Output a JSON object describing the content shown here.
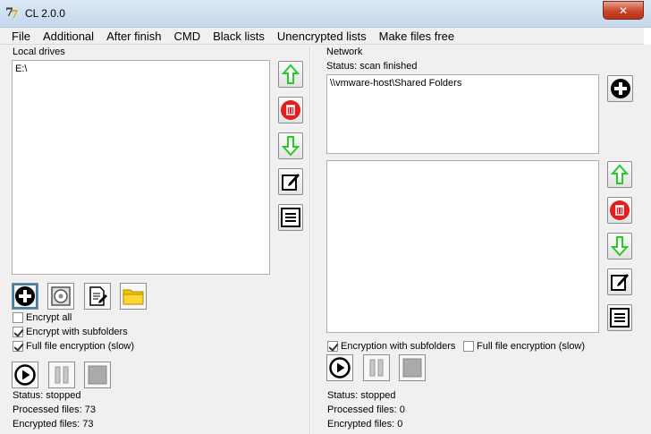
{
  "window": {
    "title": "CL 2.0.0",
    "close_glyph": "✕"
  },
  "menu": [
    "File",
    "Additional",
    "After finish",
    "CMD",
    "Black lists",
    "Unencrypted lists",
    "Make files free"
  ],
  "local": {
    "section_label": "Local drives",
    "drives": [
      "E:\\"
    ],
    "checkboxes": [
      {
        "label": "Encrypt all",
        "checked": false
      },
      {
        "label": "Encrypt with subfolders",
        "checked": true
      },
      {
        "label": "Full file encryption (slow)",
        "checked": true
      }
    ],
    "status": "Status: stopped",
    "processed": "Processed files: 73",
    "encrypted": "Encrypted files: 73"
  },
  "network": {
    "section_label": "Network",
    "scan_status": "Status: scan finished",
    "shares": [
      "\\\\vmware-host\\Shared Folders"
    ],
    "checkboxes": [
      {
        "label": "Encryption with subfolders",
        "checked": true
      },
      {
        "label": "Full file encryption (slow)",
        "checked": false
      }
    ],
    "status": "Status: stopped",
    "processed": "Processed files: 0",
    "encrypted": "Encrypted files: 0"
  },
  "colors": {
    "green_arrow": "#22cc22",
    "red_delete": "#e02020",
    "folder_yellow": "#f2c200"
  }
}
